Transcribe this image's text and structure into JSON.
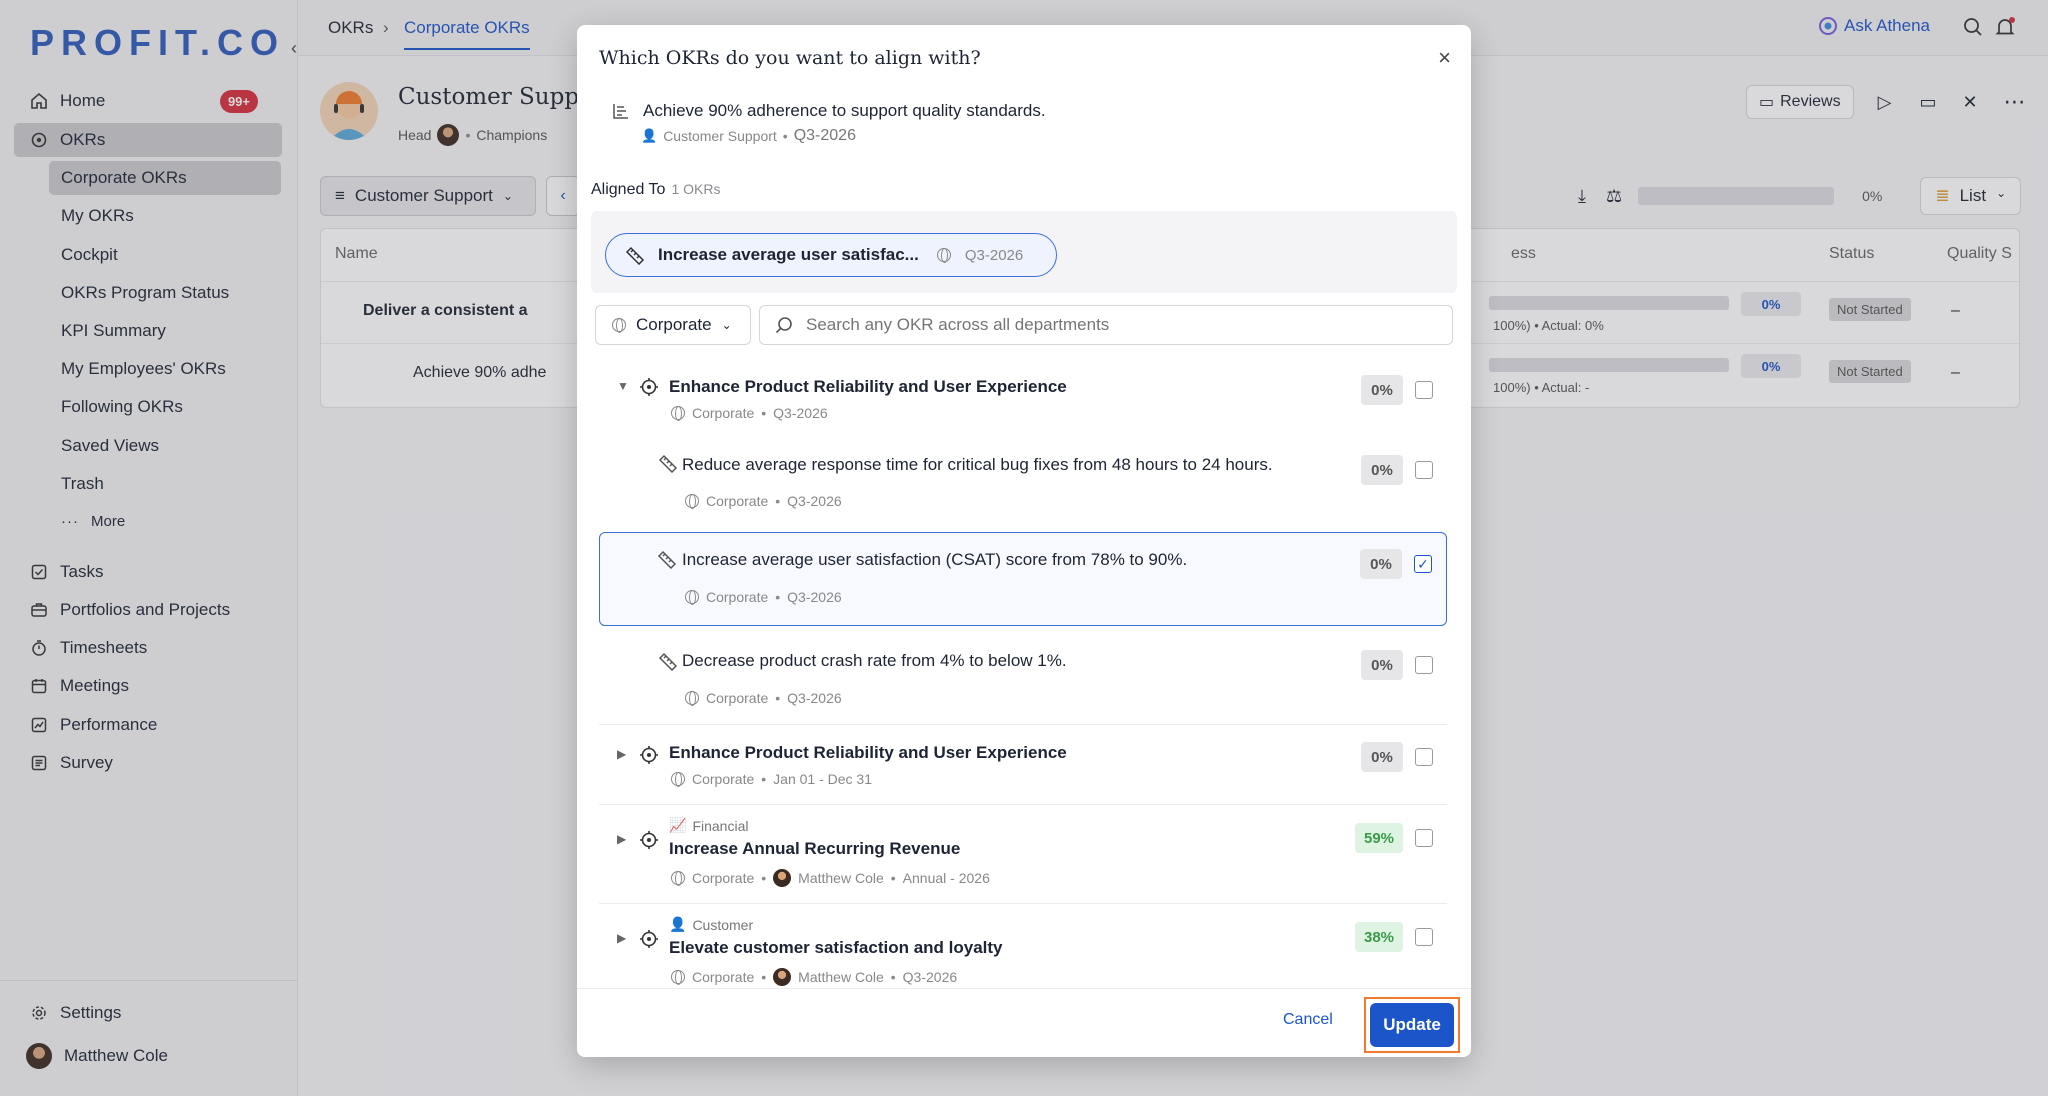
{
  "sidebar": {
    "logo": "PROFIT.CO",
    "home": "Home",
    "home_badge": "99+",
    "okrs": "OKRs",
    "sub_items": [
      "Corporate OKRs",
      "My OKRs",
      "Cockpit",
      "OKRs Program Status",
      "KPI Summary",
      "My Employees' OKRs",
      "Following OKRs",
      "Saved Views",
      "Trash"
    ],
    "more": "More",
    "nav": [
      "Tasks",
      "Portfolios and Projects",
      "Timesheets",
      "Meetings",
      "Performance",
      "Survey"
    ],
    "settings": "Settings",
    "user": "Matthew Cole"
  },
  "topbar": {
    "breadcrumb_root": "OKRs",
    "active_tab": "Corporate OKRs",
    "ask_athena": "Ask Athena"
  },
  "page": {
    "title": "Customer Suppo",
    "head_label": "Head",
    "champions_label": "Champions",
    "department_filter": "Customer Support",
    "progress_pct": "0%",
    "view_mode": "List",
    "reviews": "Reviews",
    "columns": {
      "name": "Name",
      "progress": "ess",
      "status": "Status",
      "quality": "Quality S"
    },
    "rows": [
      {
        "name": "Deliver a consistent a",
        "pct": "0%",
        "detail": "100%) • Actual: 0%",
        "status": "Not Started",
        "quality": "–"
      },
      {
        "name": "Achieve 90% adhe",
        "pct": "0%",
        "detail": "100%) • Actual: -",
        "status": "Not Started",
        "quality": "–"
      }
    ]
  },
  "modal": {
    "title": "Which OKRs do you want to align with?",
    "source_okr": "Achieve 90% adherence to support quality standards.",
    "source_dept": "Customer Support",
    "source_period": "Q3-2026",
    "aligned_label": "Aligned To",
    "aligned_count": "1 OKRs",
    "chip_label": "Increase average user satisfac...",
    "chip_period": "Q3-2026",
    "filter": "Corporate",
    "search_placeholder": "Search any OKR across all departments",
    "items": [
      {
        "title": "Enhance Product Reliability and User Experience",
        "dept": "Corporate",
        "period": "Q3-2026",
        "pct": "0%"
      },
      {
        "title": "Reduce average response time for critical bug fixes from 48 hours to 24 hours.",
        "dept": "Corporate",
        "period": "Q3-2026",
        "pct": "0%"
      },
      {
        "title": "Increase average user satisfaction (CSAT) score from 78% to 90%.",
        "dept": "Corporate",
        "period": "Q3-2026",
        "pct": "0%"
      },
      {
        "title": "Decrease product crash rate from 4% to below 1%.",
        "dept": "Corporate",
        "period": "Q3-2026",
        "pct": "0%"
      },
      {
        "title": "Enhance Product Reliability and User Experience",
        "dept": "Corporate",
        "period": "Jan 01 - Dec 31",
        "pct": "0%"
      },
      {
        "perspective": "Financial",
        "title": "Increase Annual Recurring Revenue",
        "dept": "Corporate",
        "owner": "Matthew Cole",
        "period": "Annual - 2026",
        "pct": "59%"
      },
      {
        "perspective": "Customer",
        "title": "Elevate customer satisfaction and loyalty",
        "dept": "Corporate",
        "owner": "Matthew Cole",
        "period": "Q3-2026",
        "pct": "38%"
      }
    ],
    "cancel": "Cancel",
    "update": "Update"
  },
  "colors": {
    "accent": "#1b55c9",
    "highlight": "#f07a2a",
    "badge": "#d62e3b",
    "success": "#3a9a4a"
  }
}
